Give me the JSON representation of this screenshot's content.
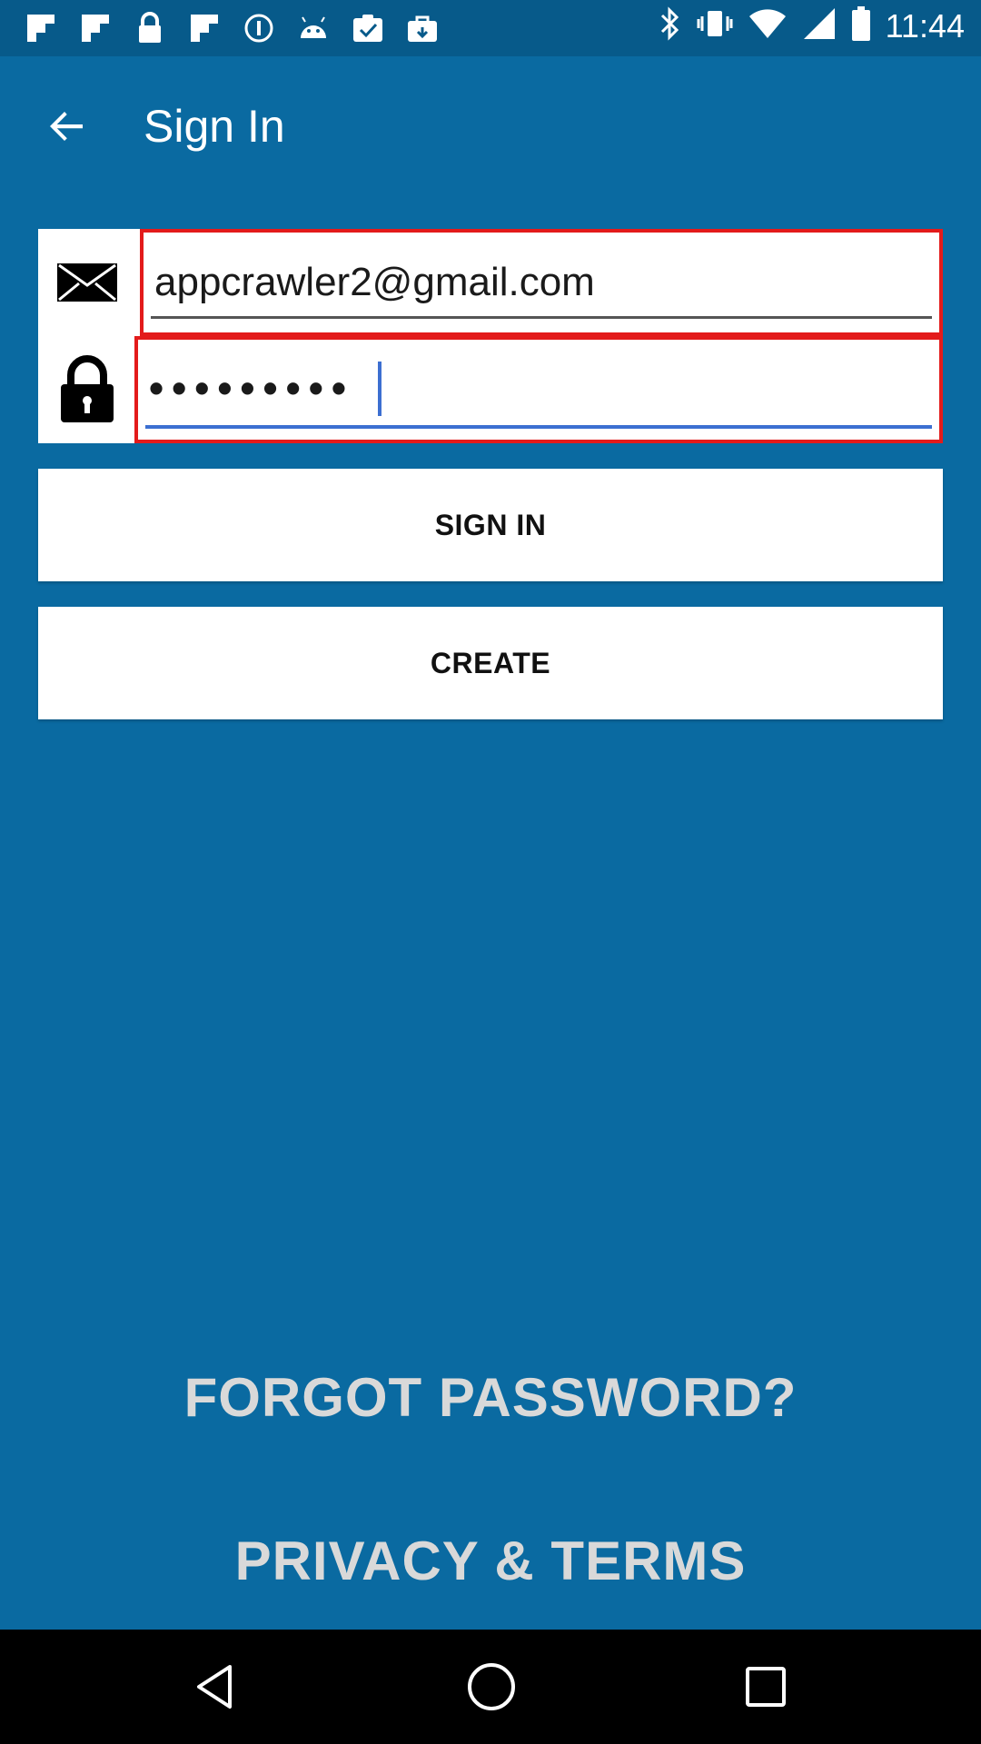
{
  "status_bar": {
    "time": "11:44",
    "left_icons": [
      "flipboard-icon",
      "flipboard-icon",
      "lock-icon",
      "flipboard-icon",
      "info-icon",
      "android-icon",
      "clipboard-check-icon",
      "bag-icon"
    ],
    "right_icons": [
      "bluetooth-icon",
      "vibrate-icon",
      "wifi-icon",
      "signal-icon",
      "battery-icon"
    ]
  },
  "app_bar": {
    "title": "Sign In",
    "back_icon": "arrow-back-icon"
  },
  "form": {
    "email_icon": "envelope-icon",
    "email_value": "appcrawler2@gmail.com",
    "password_icon": "padlock-icon",
    "password_value": "•••••••••"
  },
  "buttons": {
    "sign_in": "SIGN IN",
    "create": "CREATE"
  },
  "links": {
    "forgot_password": "FORGOT PASSWORD?",
    "privacy_terms": "PRIVACY & TERMS"
  },
  "nav_bar": {
    "back": "back-triangle-icon",
    "home": "home-circle-icon",
    "recents": "recents-square-icon"
  },
  "colors": {
    "background": "#0a6aa1",
    "status_bar": "#075a8a",
    "field_highlight": "#e31b1b",
    "link_text": "#d9d9d9",
    "active_underline": "#3c6fd1"
  }
}
